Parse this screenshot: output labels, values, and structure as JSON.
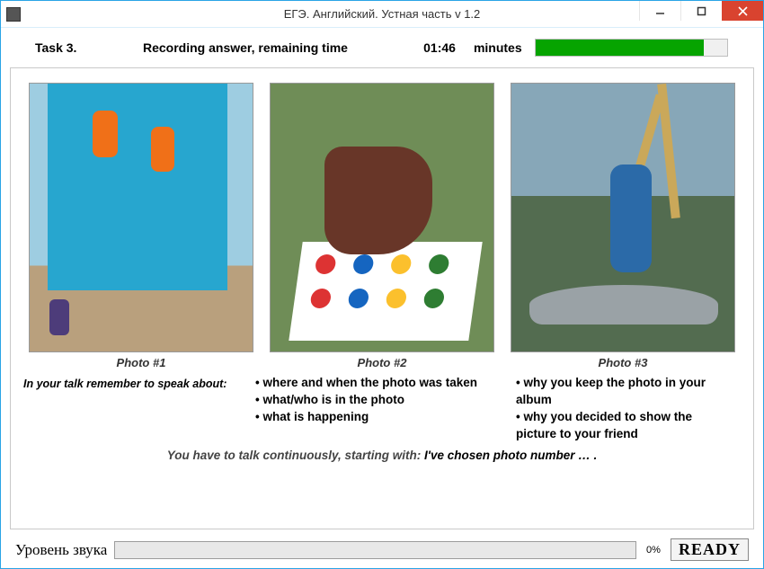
{
  "window": {
    "title": "ЕГЭ. Английский. Устная часть v 1.2"
  },
  "status": {
    "task_label": "Task 3.",
    "status_text": "Recording answer, remaining time",
    "time_value": "01:46",
    "minutes_label": "minutes",
    "progress_pct": 88
  },
  "photos": [
    {
      "caption": "Photo #1",
      "alt": "climbing-wall-scene"
    },
    {
      "caption": "Photo #2",
      "alt": "twister-game-scene"
    },
    {
      "caption": "Photo #3",
      "alt": "kayak-paddles-scene"
    }
  ],
  "instructions": {
    "lead": "In your talk remember to speak about:",
    "col1": [
      "where  and  when  the  photo was taken",
      "what/who is in the photo",
      "what is happening"
    ],
    "col2": [
      "why you keep the photo in your album",
      "why you decided to show the picture to your friend"
    ],
    "continuation_prefix": "You have to talk continuously, starting with: ",
    "continuation_bold": "I've chosen photo number … ."
  },
  "bottom": {
    "sound_label": "Уровень звука",
    "level_pct": "0%",
    "ready_label": "READY"
  }
}
